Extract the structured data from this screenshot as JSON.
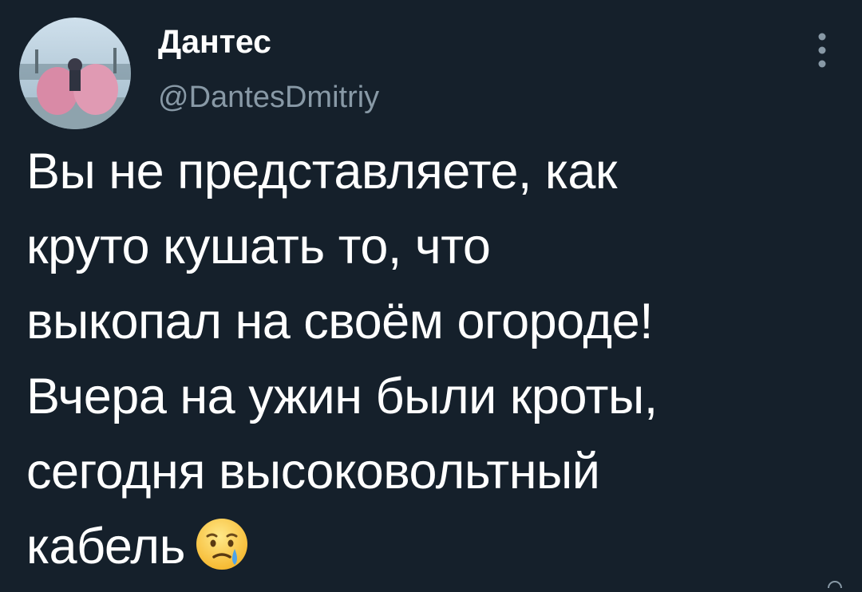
{
  "tweet": {
    "author_name": "Дантес",
    "author_handle": "@DantesDmitriy",
    "text_line_1": "Вы не представляете, как",
    "text_line_2": "круто кушать то, что",
    "text_line_3": "выкопал на своём огороде!",
    "text_line_4": "Вчера на ужин были кроты,",
    "text_line_5": "сегодня высоковольтный",
    "text_line_6": "кабель"
  },
  "icons": {
    "more": "more-vertical-icon",
    "emoji": "sad-tear-face-emoji"
  },
  "colors": {
    "background": "#15202b",
    "text": "#ffffff",
    "secondary_text": "#8899a6"
  }
}
